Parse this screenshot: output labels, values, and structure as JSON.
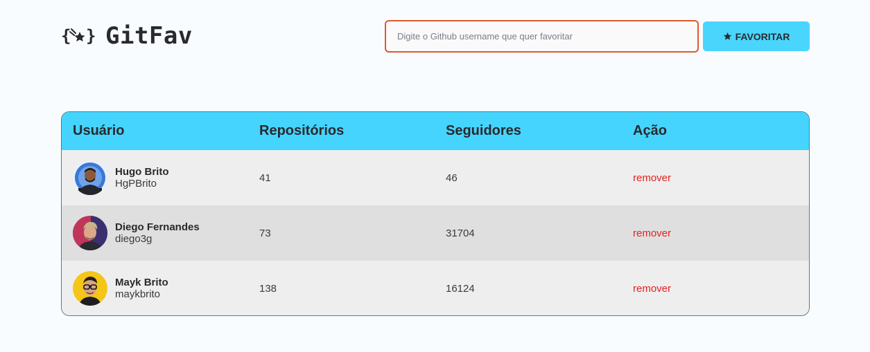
{
  "app": {
    "logo_text": "GitFav",
    "logo_icon": "braces-star-icon"
  },
  "search": {
    "placeholder": "Digite o Github username que quer favoritar",
    "value": ""
  },
  "favorite_button": {
    "label": "FAVORITAR",
    "icon": "star-icon"
  },
  "table": {
    "headers": [
      "Usuário",
      "Repositórios",
      "Seguidores",
      "Ação"
    ],
    "rows": [
      {
        "name": "Hugo Brito",
        "login": "HgPBrito",
        "repositories": "41",
        "followers": "46",
        "action": "remover"
      },
      {
        "name": "Diego Fernandes",
        "login": "diego3g",
        "repositories": "73",
        "followers": "31704",
        "action": "remover"
      },
      {
        "name": "Mayk Brito",
        "login": "maykbrito",
        "repositories": "138",
        "followers": "16124",
        "action": "remover"
      }
    ]
  },
  "colors": {
    "accent": "#4ad5fd",
    "input_border": "#e0582a",
    "remove": "#e62020",
    "background": "#f8fcff"
  }
}
